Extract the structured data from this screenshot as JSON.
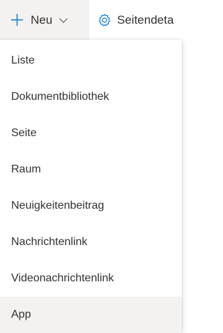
{
  "toolbar": {
    "new_label": "Neu",
    "details_label": "Seitendeta",
    "icons": {
      "new": "plus-icon",
      "chevron": "chevron-down-icon",
      "details": "gear-icon"
    },
    "accent_color": "#0078d4"
  },
  "menu": {
    "items": [
      {
        "label": "Liste"
      },
      {
        "label": "Dokumentbibliothek"
      },
      {
        "label": "Seite"
      },
      {
        "label": "Raum"
      },
      {
        "label": "Neuigkeitenbeitrag"
      },
      {
        "label": "Nachrichtenlink"
      },
      {
        "label": "Videonachrichtenlink"
      },
      {
        "label": "App"
      }
    ],
    "hovered_item": "App"
  }
}
